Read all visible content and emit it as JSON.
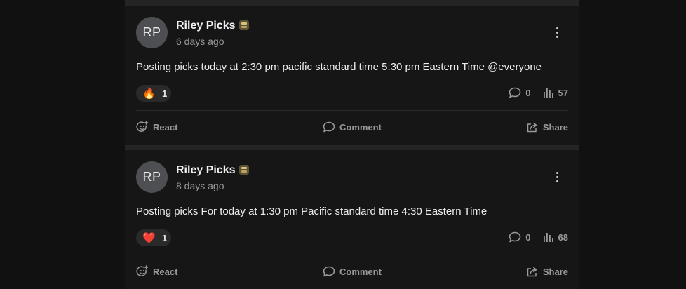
{
  "posts": [
    {
      "avatar_initials": "RP",
      "author": "Riley Picks",
      "badge_icon": "ledger-badge-icon",
      "time": "6 days ago",
      "text": "Posting picks today at 2:30 pm pacific standard time 5:30 pm Eastern Time @everyone",
      "reaction": {
        "emoji": "🔥",
        "count": "1"
      },
      "comments": "0",
      "views": "57"
    },
    {
      "avatar_initials": "RP",
      "author": "Riley Picks",
      "badge_icon": "ledger-badge-icon",
      "time": "8 days ago",
      "text": "Posting picks For today at 1:30 pm Pacific standard time 4:30 Eastern Time",
      "reaction": {
        "emoji": "❤️",
        "count": "1"
      },
      "comments": "0",
      "views": "68"
    }
  ],
  "actions": {
    "react": "React",
    "comment": "Comment",
    "share": "Share"
  },
  "colors": {
    "background": "#111111",
    "card": "#161616",
    "muted": "#9a9a9a",
    "avatar": "#4d4f53"
  }
}
